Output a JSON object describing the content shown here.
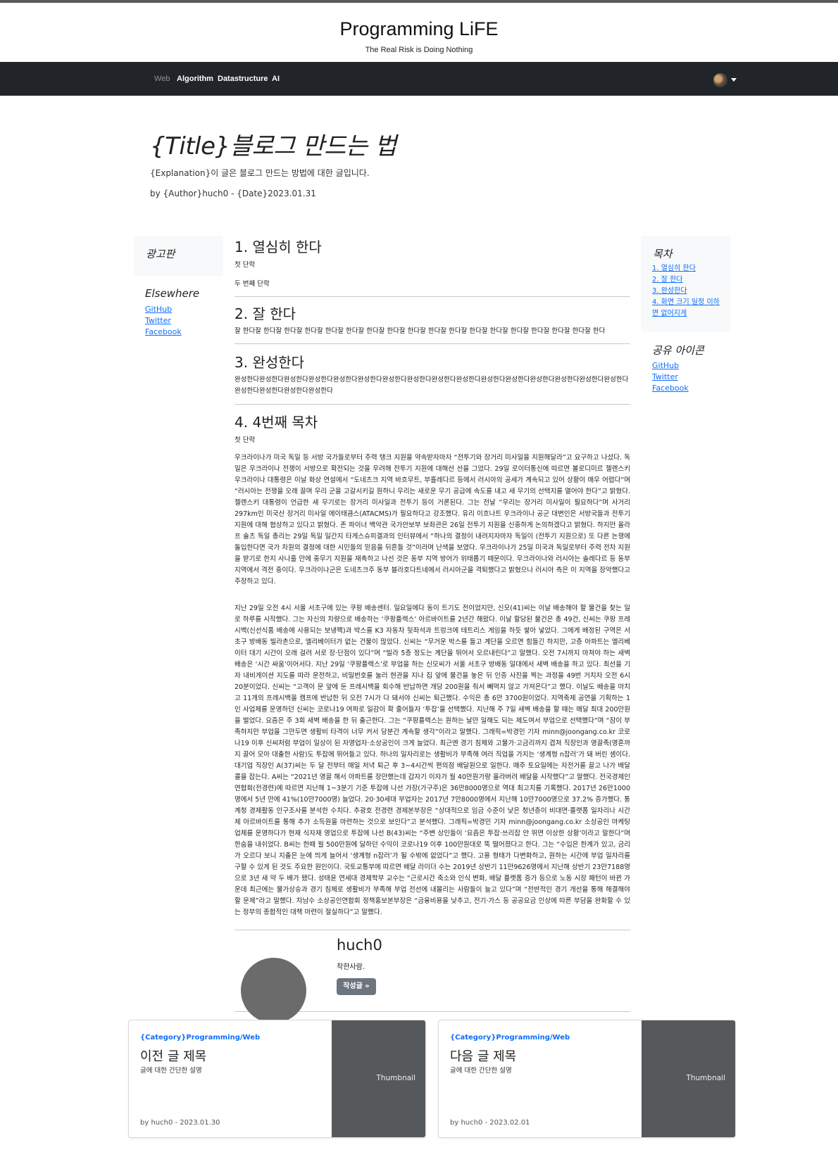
{
  "header": {
    "title": "Programming LiFE",
    "subtitle": "The Real Risk is Doing Nothing"
  },
  "nav": {
    "items": [
      {
        "label": "Web",
        "muted": true
      },
      {
        "label": "Algorithm",
        "muted": false
      },
      {
        "label": "Datastructure",
        "muted": false
      },
      {
        "label": "AI",
        "muted": false
      }
    ]
  },
  "post": {
    "title": "{Title}블로그 만드는 법",
    "explanation": "{Explanation}이 글은 블로그 만드는 방법에 대한 글입니다.",
    "meta": "by {Author}huch0 - {Date}2023.01.31"
  },
  "left_sidebar": {
    "ad_title": "광고판",
    "elsewhere_title": "Elsewhere",
    "links": [
      "GitHub",
      "Twitter",
      "Facebook"
    ]
  },
  "sections": {
    "s1": {
      "title": "1. 열심히 한다",
      "p1": "첫 단락",
      "p2": "두 번째 단락"
    },
    "s2": {
      "title": "2. 잘 한다",
      "p1": "잘 한다잘 한다잘 한다잘 한다잘 한다잘 한다잘 한다잘 한다잘 한다잘 한다잘 한다잘 한다잘 한다잘 한다잘 한다잘 한다잘 한다잘 한다"
    },
    "s3": {
      "title": "3. 완성한다",
      "p1": "완성한다완성한다완성한다완성한다완성한다완성한다완성한다완성한다완성한다완성한다완성한다완성한다완성한다완성한다완성한다완성한다완성한다완성한다완성한다완성한다"
    },
    "s4": {
      "title": "4. 4번째 목차",
      "p1": "첫 단락",
      "long1": "우크라이나가 미국 독일 등 서방 국가들로부터 주력 탱크 지원을 약속받자마자 “전투기와 장거리 미사일을 지원해달라”고 요구하고 나섰다. 독일은 우크라이나 전쟁이 서방으로 확전되는 것을 우려해 전투기 지원에 대해선 선을 그었다. 29일 로이터통신에 따르면 볼로디미르 젤렌스키 우크라이나 대통령은 이날 화상 연설에서 “도네츠크 지역 바흐무트, 부흘레다르 등에서 러시아의 공세가 계속되고 있어 상황이 매우 어렵다”며 “러시아는 전쟁을 오래 끌며 우리 군을 고갈시키길 원하니 우리는 새로운 무기 공급에 속도를 내고 새 무기의 선택지를 열어야 한다”고 밝혔다. 젤렌스키 대통령이 언급한 새 무기로는 장거리 미사일과 전투기 등이 거론된다. 그는 전날 “우리는 장거리 미사일이 필요하다”며 사거리 297km인 미국산 장거리 미사일 에이태큼스(ATACMS)가 필요하다고 강조했다. 유리 이흐나트 우크라이나 공군 대변인은 서방국들과 전투기 지원에 대해 협상하고 있다고 밝혔다. 존 파이너 백악관 국가안보부 보좌관은 26일 전투기 지원을 신중하게 논의하겠다고 밝혔다. 하지만 올라프 숄츠 독일 총리는 29일 독일 일간지 타게스슈피겔과의 인터뷰에서 “하나의 결정이 내려지자마자 독일이 (전투기 지원으로) 또 다른 논쟁에 돌입한다면 국가 차원의 결정에 대한 시민들의 믿음을 뒤흔들 것”이라며 난색을 보였다. 우크라이나가 25일 미국과 독일로부터 주력 전차 지원을 받기로 한지 사나흘 만에 중무기 지원을 재촉하고 나선 것은 동부 지역 방어가 위태롭기 때문이다. 우크라이나와 러시아는 솔레다르 등 동부 지역에서 격전 중이다. 우크라이나군은 도네츠크주 동부 블라호다트네에서 러시아군을 격퇴했다고 밝혔으나 러시아 측은 이 지역을 장악했다고 주장하고 있다.",
      "long2": "지난 29일 오전 4시 서울 서초구에 있는 쿠팡 배송센터. 일요일에다 동이 트기도 전이었지만, 신모(41)씨는 이날 배송해야 할 물건을 찾는 일로 하루를 시작했다. 그는 자신의 차량으로 배송하는 ‘쿠팡플렉스’ 아르바이트를 2년간 해왔다. 이날 할당된 물건은 총 49건, 신씨는 쿠팡 프레시백(신선식품 배송에 사용되는 보냉팩)과 박스를 K3 자동차 뒷좌석과 트렁크에 테트리스 게임을 하듯 쌓아 넣었다. 그에게 배정된 구역은 서초구 방배동 빌라촌으로, 엘리베이터가 없는 건물이 많았다. 신씨는 “무거운 박스를 들고 계단을 오르면 힘들긴 하지만, 고층 아파트는 엘리베이터 대기 시간이 오래 걸려 서로 장·단점이 있다”며 “빌라 5층 정도는 계단을 뛰어서 오르내린다”고 말했다. 오전 7시까지 마쳐야 하는 새벽 배송은 ‘시간 싸움’이어서다. 지난 29일 ‘쿠팡플렉스’로 부업을 하는 신모씨가 서울 서초구 방배동 일대에서 새벽 배송을 하고 있다. 최선을 기자 내비게이션 지도를 따라 운전하고, 비밀번호를 눌러 현관을 지나 집 앞에 물건을 놓은 뒤 인증 사진을 찍는 과정을 49번 거치자 오전 6시 20분이었다. 신씨는 “고객이 문 앞에 둔 프레시백을 회수해 반납하면 개당 200원을 줘서 빼먹지 않고 가져온다”고 했다. 이날도 배송을 마치고 11개의 프레시백을 캠프에 반납한 뒤 오전 7시가 다 돼서야 신씨는 퇴근했다. 수익은 총 6만 3700원이었다. 지역축제 공연을 기획하는 1인 사업체를 운영하던 신씨는 코로나19 여파로 일감이 확 줄어들자 ‘투잡’을 선택했다. 지난해 주 7일 새벽 배송을 할 때는 매달 최대 200만원을 벌었다. 요즘은 주 3회 새벽 배송을 한 뒤 출근한다. 그는 “쿠팡플렉스는 원하는 날만 일해도 되는 제도여서 부업으로 선택했다”며 “잠이 부족하지만 부업을 그만두면 생활비 타격이 너무 커서 당분간 계속할 생각”이라고 말했다. 그래픽=박경민 기자 minn@joongang.co.kr 코로나19 이후 신씨처럼 부업이 일상이 된 자영업자·소상공인이 크게 늘었다. 최근엔 경기 침체와 고물가·고금리까지 겹쳐 직장인과 영끌족(영혼까지 끌어 모아 대출한 사람)도 투잡에 뛰어들고 있다. 하나의 일자리로는 생활비가 부족해 여러 직업을 가지는 ‘생계형 n잡러’가 돼 버린 셈이다. 대기업 직장인 A(37)씨는 두 달 전부터 매일 저녁 퇴근 후 3~4시간씩 편의점 배달원으로 일한다. 매주 토요일에는 자전거를 끌고 나가 배달 콜을 잡는다. A씨는 “2021년 영끌 해서 아파트를 장만했는데 갑자기 이자가 월 40만원가량 올라버려 배달을 시작했다”고 말했다. 전국경제인연합회(전경련)에 따르면 지난해 1~3분기 기준 투잡에 나선 가장(가구주)은 36만8000명으로 역대 최고치를 기록했다. 2017년 26만1000명에서 5년 만에 41%(10만7000명) 늘었다. 20·30세대 부업자는 2017년 7만8000명에서 지난해 10만7000명으로 37.2% 증가했다. 통계청 경제활동 인구조사를 분석한 수치다. 추광호 전경련 경제본부장은 “상대적으로 임금 수준이 낮은 청년층이 비대면·플랫폼 일자리나 시간제 아르바이트를 통해 추가 소득원을 마련하는 것으로 보인다”고 분석했다. 그래픽=박경민 기자 minn@joongang.co.kr 소상공인 마케팅 업체를 운영하다가 현재 식자재 영업으로 투잡에 나선 B(43)씨는 “주변 상인들이 ‘요즘은 투잡·쓰리잡 안 뛰면 이상한 상황’이라고 말한다”며 한숨을 내쉬었다. B씨는 한때 월 500만원에 달하던 수익이 코로나19 이후 100만원대로 뚝 떨어졌다고 한다. 그는 “수입은 한계가 있고, 금리가 오르다 보니 지출은 눈에 띄게 늘어서 ‘생계형 n잡러’가 될 수밖에 없었다”고 했다. 고용 형태가 다변화하고, 원하는 시간에 부업 일자리를 구할 수 있게 된 것도 주요한 원인이다. 국토교통부에 따르면 배달 라이더 수는 2019년 상반기 11만9626명에서 지난해 상반기 23만7188명으로 3년 새 약 두 배가 됐다. 성태윤 연세대 경제학부 교수는 “근로시간 축소와 인식 변화, 배달 플랫폼 증가 등으로 노동 시장 패턴이 바뀐 가운데 최근에는 물가상승과 경기 침체로 생활비가 부족해 부업 전선에 내몰리는 사람들이 늘고 있다”며 “전반적인 경기 개선을 통해 해결해야 할 문제”라고 말했다. 차남수 소상공인연합회 정책홍보본부장은 “금융비용을 낮추고, 전기·가스 등 공공요금 인상에 따른 부담을 완화할 수 있는 정부의 종합적인 대책 마련이 절실하다”고 말했다."
    }
  },
  "author": {
    "name": "huch0",
    "desc": "착한사람.",
    "button": "작성글 »"
  },
  "toc": {
    "title": "목차",
    "items": [
      "1. 열심히 한다",
      "2. 잘 한다",
      "3. 완성한다",
      "4. 화면 크기 일정 이하",
      "면 없어지게"
    ]
  },
  "share": {
    "title": "공유 아이콘",
    "links": [
      "GitHub",
      "Twitter",
      "Facebook"
    ]
  },
  "cards": {
    "prev": {
      "category": "{Category}Programming/Web",
      "title": "이전 글 제목",
      "desc": "글에 대한 간단한 설명",
      "meta": "by huch0 - 2023.01.30",
      "thumb": "Thumbnail"
    },
    "next": {
      "category": "{Category}Programming/Web",
      "title": "다음 글 제목",
      "desc": "글에 대한 간단한 설명",
      "meta": "by huch0 - 2023.02.01",
      "thumb": "Thumbnail"
    }
  },
  "colors": {
    "navbar": "#212529",
    "link": "#0d6efd",
    "button": "#6c757d",
    "thumbnail": "#55595c"
  }
}
